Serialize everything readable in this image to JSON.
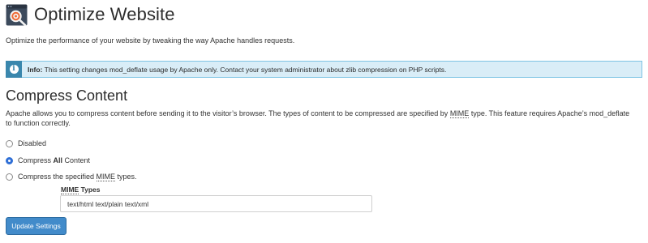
{
  "header": {
    "title": "Optimize Website",
    "icon": "optimize-website-icon"
  },
  "description": "Optimize the performance of your website by tweaking the way Apache handles requests.",
  "info": {
    "icon": "info-icon",
    "label": "Info:",
    "text": " This setting changes mod_deflate usage by Apache only. Contact your system administrator about zlib compression on PHP scripts."
  },
  "section": {
    "title": "Compress Content",
    "description_part1": "Apache allows you to compress content before sending it to the visitor’s browser. The types of content to be compressed are specified by ",
    "description_abbr": "MIME",
    "description_part2": " type. This feature requires Apache’s mod_deflate to function correctly."
  },
  "options": {
    "disabled": {
      "label": "Disabled",
      "selected": false
    },
    "all": {
      "label_prefix": "Compress ",
      "label_bold": "All",
      "label_suffix": " Content",
      "selected": true
    },
    "specified": {
      "label_prefix": "Compress the specified ",
      "label_abbr": "MIME",
      "label_suffix": " types.",
      "selected": false
    }
  },
  "mime": {
    "label_abbr": "MIME",
    "label_suffix": " Types",
    "value": "text/html text/plain text/xml"
  },
  "buttons": {
    "update": "Update Settings"
  },
  "colors": {
    "info_bg": "#d9edf7",
    "info_icon_bg": "#3a87ad",
    "button_bg": "#428bca",
    "radio_selected": "#2f6fd6"
  }
}
